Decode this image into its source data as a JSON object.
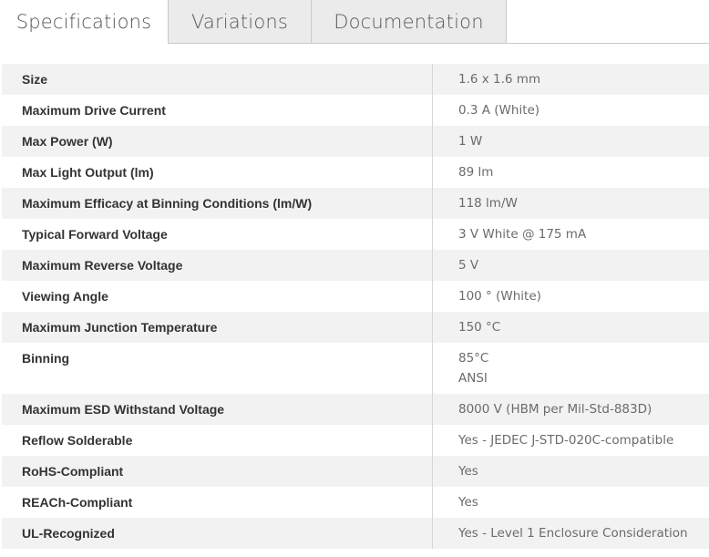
{
  "tabs": [
    {
      "label": "Specifications",
      "active": true
    },
    {
      "label": "Variations",
      "active": false
    },
    {
      "label": "Documentation",
      "active": false
    }
  ],
  "specs": [
    {
      "label": "Size",
      "values": [
        "1.6 x 1.6 mm"
      ]
    },
    {
      "label": "Maximum Drive Current",
      "values": [
        "0.3 A (White)"
      ]
    },
    {
      "label": "Max Power (W)",
      "values": [
        "1 W"
      ]
    },
    {
      "label": "Max Light Output (lm)",
      "values": [
        "89 lm"
      ]
    },
    {
      "label": "Maximum Efficacy at Binning Conditions (lm/W)",
      "values": [
        "118 lm/W"
      ]
    },
    {
      "label": "Typical Forward Voltage",
      "values": [
        "3 V White @ 175 mA"
      ]
    },
    {
      "label": "Maximum Reverse Voltage",
      "values": [
        "5 V"
      ]
    },
    {
      "label": "Viewing Angle",
      "values": [
        "100 ° (White)"
      ]
    },
    {
      "label": "Maximum Junction Temperature",
      "values": [
        "150 °C"
      ]
    },
    {
      "label": "Binning",
      "values": [
        "85°C",
        "ANSI"
      ]
    },
    {
      "label": "Maximum ESD Withstand Voltage",
      "values": [
        "8000 V (HBM per Mil-Std-883D)"
      ]
    },
    {
      "label": "Reflow Solderable",
      "values": [
        "Yes - JEDEC J-STD-020C-compatible"
      ]
    },
    {
      "label": "RoHS-Compliant",
      "values": [
        "Yes"
      ]
    },
    {
      "label": "REACh-Compliant",
      "values": [
        "Yes"
      ]
    },
    {
      "label": "UL-Recognized",
      "values": [
        "Yes - Level 1 Enclosure Consideration"
      ]
    }
  ],
  "colors": {
    "row_shade": "#f2f2f2",
    "inactive_tab": "#ebebeb",
    "label_text": "#333333",
    "value_text": "#6b6b6b"
  }
}
